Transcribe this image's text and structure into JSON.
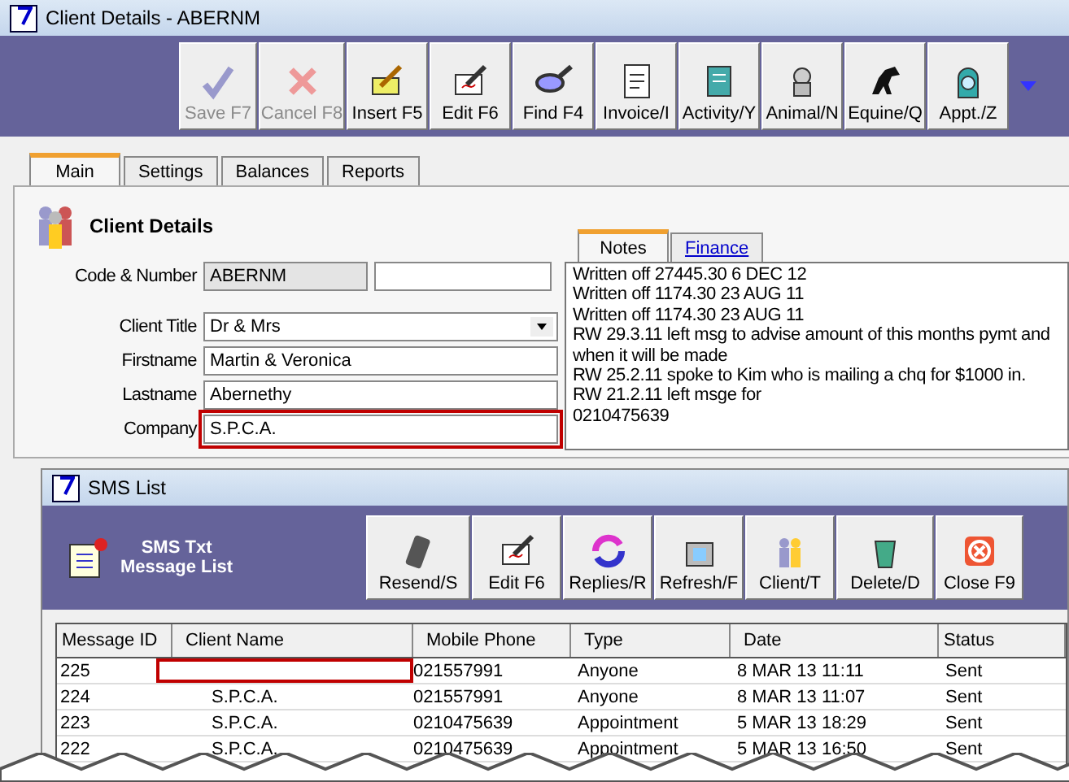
{
  "window": {
    "title": "Client Details - ABERNM"
  },
  "toolbar": [
    {
      "label": "Save F7",
      "disabled": true
    },
    {
      "label": "Cancel F8",
      "disabled": true
    },
    {
      "label": "Insert F5",
      "disabled": false
    },
    {
      "label": "Edit F6",
      "disabled": false
    },
    {
      "label": "Find F4",
      "disabled": false
    },
    {
      "label": "Invoice/I",
      "disabled": false
    },
    {
      "label": "Activity/Y",
      "disabled": false
    },
    {
      "label": "Animal/N",
      "disabled": false
    },
    {
      "label": "Equine/Q",
      "disabled": false
    },
    {
      "label": "Appt./Z",
      "disabled": false
    }
  ],
  "tabs": [
    {
      "label": "Main",
      "selected": true
    },
    {
      "label": "Settings",
      "selected": false
    },
    {
      "label": "Balances",
      "selected": false
    },
    {
      "label": "Reports",
      "selected": false
    }
  ],
  "section_title": "Client Details",
  "fields": [
    {
      "label": "Code & Number",
      "kind": "code",
      "value": "ABERNM",
      "highlighted": false
    },
    {
      "label": "Client Title",
      "kind": "dropdown",
      "value": "Dr & Mrs",
      "highlighted": false
    },
    {
      "label": "Firstname",
      "kind": "text",
      "value": "Martin & Veronica",
      "highlighted": false
    },
    {
      "label": "Lastname",
      "kind": "text",
      "value": "Abernethy",
      "highlighted": false
    },
    {
      "label": "Company",
      "kind": "text",
      "value": "S.P.C.A.",
      "highlighted": true
    }
  ],
  "notes_tabs": [
    {
      "label": "Notes",
      "selected": true
    },
    {
      "label": "Finance",
      "selected": false
    }
  ],
  "notes": [
    "Written off 27445.30 6 DEC 12",
    "Written off 1174.30 23 AUG 11",
    "Written off 1174.30 23 AUG 11",
    "RW 29.3.11 left msg to advise amount of this months pymt and when it will be made",
    "RW 25.2.11 spoke to Kim who is mailing a chq for $1000 in.",
    "RW 21.2.11 left msge for",
    "0210475639"
  ],
  "sms_window": {
    "title": "SMS List",
    "heading": "SMS Txt\nMessage List",
    "toolbar": [
      "Resend/S",
      "Edit F6",
      "Replies/R",
      "Refresh/F",
      "Client/T",
      "Delete/D",
      "Close F9"
    ],
    "table": {
      "columns": [
        "Message ID",
        "Client Name",
        "Mobile Phone",
        "Type",
        "Date",
        "Status"
      ],
      "rows": [
        {
          "cells": [
            "225",
            "",
            "021557991",
            "Anyone",
            "8 MAR 13  11:11",
            "Sent"
          ],
          "highlighted": true
        },
        {
          "cells": [
            "224",
            "S.P.C.A.",
            "021557991",
            "Anyone",
            "8 MAR 13  11:07",
            "Sent"
          ],
          "highlighted": false
        },
        {
          "cells": [
            "223",
            "S.P.C.A.",
            "0210475639",
            "Appointment",
            "5 MAR 13  18:29",
            "Sent"
          ],
          "highlighted": false
        },
        {
          "cells": [
            "222",
            "S.P.C.A.",
            "0210475639",
            "Appointment",
            "5 MAR 13  16:50",
            "Sent"
          ],
          "highlighted": false
        }
      ]
    }
  }
}
